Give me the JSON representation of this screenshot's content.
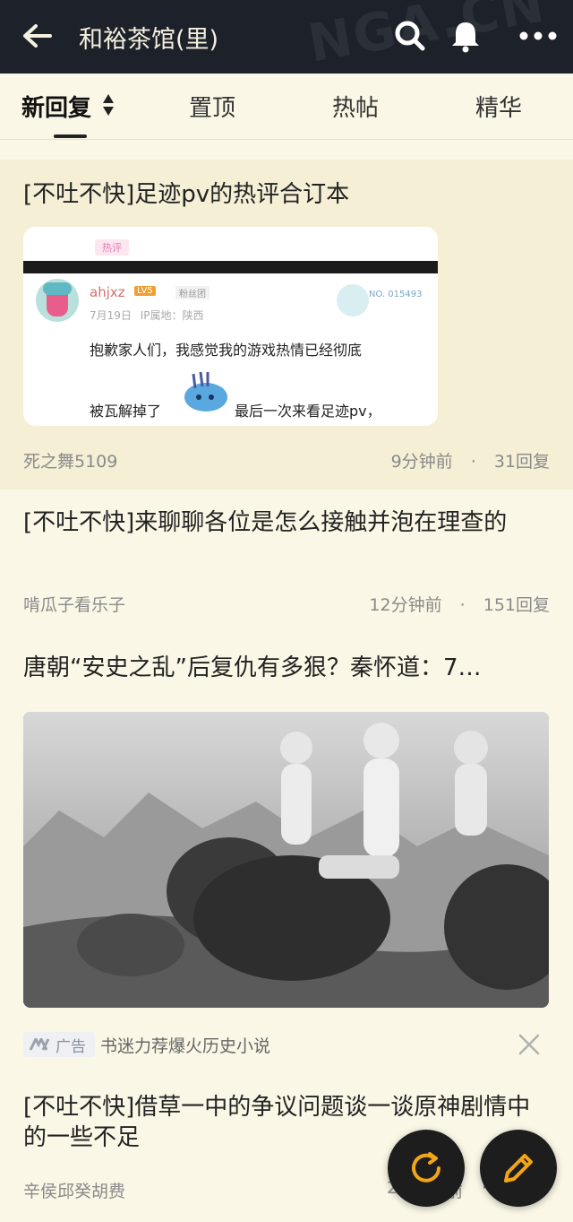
{
  "header": {
    "title": "和裕茶馆(里)",
    "watermark": "NGA.CN",
    "icons": [
      "back-arrow-icon",
      "search-icon",
      "bell-icon",
      "more-icon"
    ]
  },
  "tabs": [
    {
      "label": "新回复",
      "active": true
    },
    {
      "label": "置顶",
      "active": false
    },
    {
      "label": "热帖",
      "active": false
    },
    {
      "label": "精华",
      "active": false
    }
  ],
  "posts": [
    {
      "title": "[不吐不快]足迹pv的热评合订本",
      "author": "死之舞5109",
      "time": "9分钟前",
      "sep": "·",
      "replies": "31回复",
      "thumb": {
        "tag": "热评",
        "user": "ahjxz",
        "level": "LV5",
        "group": "粉丝团",
        "date": "7月19日",
        "ip": "IP属地：陕西",
        "no": "NO. 015493",
        "line1": "抱歉家人们，我感觉我的游戏热情已经彻底",
        "line2a": "被瓦解掉了",
        "line2b": "最后一次来看足迹pv，"
      }
    },
    {
      "title": "[不吐不快]来聊聊各位是怎么接触并泡在理查的",
      "author": "啃瓜子看乐子",
      "time": "12分钟前",
      "sep": "·",
      "replies": "151回复"
    },
    {
      "title": "唐朝“安史之乱”后复仇有多狠？秦怀道：7…",
      "ad_label": "广告",
      "ad_text": "书迷力荐爆火历史小说"
    },
    {
      "title": "[不吐不快]借草一中的争议问题谈一谈原神剧情中的一些不足",
      "author": "辛侯邱癸胡费",
      "time_partial": "2",
      "time_partial2": "前",
      "sep": "·"
    }
  ],
  "colors": {
    "header_bg": "#1d2129",
    "page_bg": "#fbf7e6",
    "highlight_bg": "#f5efd6",
    "fab_bg": "#1d1d1d",
    "fab_icon": "#f2a516"
  }
}
